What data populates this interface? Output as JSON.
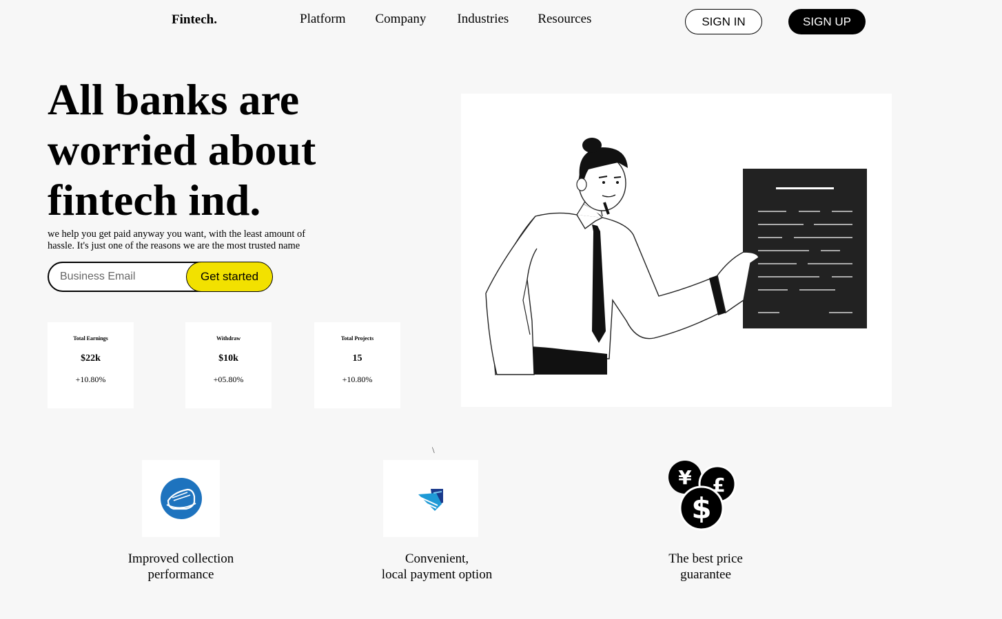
{
  "nav": {
    "logo": "Fintech.",
    "links": [
      "Platform",
      "Company",
      "Industries",
      "Resources"
    ],
    "sign_in": "SIGN IN",
    "sign_up": "SIGN UP"
  },
  "hero": {
    "title": "All banks are worried about fintech ind.",
    "subtitle": "we help you get paid anyway you want, with the least amount of hassle. It's just one of the reasons we are the most trusted name",
    "email_placeholder": "Business Email",
    "cta": "Get started"
  },
  "stats": [
    {
      "label": "Total Earnings",
      "value": "$22k",
      "change": "+10.80%"
    },
    {
      "label": "Withdraw",
      "value": "$10k",
      "change": "+05.80%"
    },
    {
      "label": "Total Projects",
      "value": "15",
      "change": "+10.80%"
    }
  ],
  "stray_mark": "\\",
  "features": [
    {
      "text": "Improved collection\nperformance",
      "icon": "wallet-icon",
      "color": "#1e73be"
    },
    {
      "text": "Convenient,\nlocal payment option",
      "icon": "card-payment-icon",
      "color": "#1e9ad6"
    },
    {
      "text": "The best price\nguarantee",
      "icon": "currency-coins-icon",
      "color": "#000000"
    }
  ],
  "colors": {
    "accent": "#f2e100",
    "background": "#f7f7f7",
    "dark": "#000000"
  }
}
